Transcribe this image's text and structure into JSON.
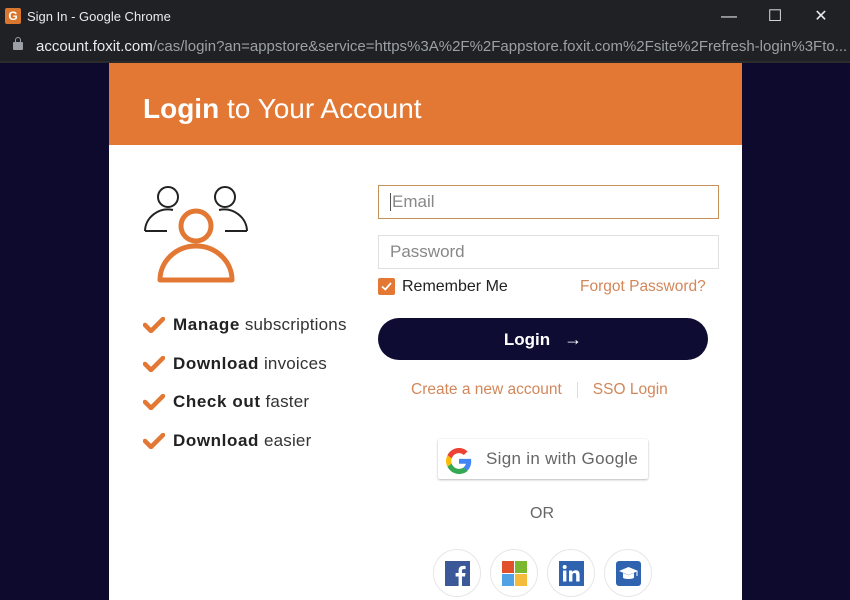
{
  "window": {
    "title": "Sign In - Google Chrome",
    "app_icon_letter": "G",
    "minimize_glyph": "—",
    "maximize_glyph": "☐",
    "close_glyph": "✕"
  },
  "address_bar": {
    "host": "account.foxit.com",
    "path": "/cas/login?an=appstore&service=https%3A%2F%2Fappstore.foxit.com%2Fsite%2Frefresh-login%3Fto..."
  },
  "header": {
    "title_bold": "Login",
    "title_rest": " to Your Account"
  },
  "features": [
    {
      "bold": "Manage",
      "rest": " subscriptions"
    },
    {
      "bold": "Download",
      "rest": " invoices"
    },
    {
      "bold": "Check out",
      "rest": " faster"
    },
    {
      "bold": "Download",
      "rest": " easier"
    }
  ],
  "form": {
    "email_placeholder": "Email",
    "email_value": "",
    "password_placeholder": "Password",
    "password_value": "",
    "remember_label": "Remember Me",
    "remember_checked": true,
    "forgot_label": "Forgot Password?",
    "login_label": "Login",
    "login_arrow": "→",
    "create_account_label": "Create a new account",
    "sso_label": "SSO Login"
  },
  "google": {
    "label": "Sign in with Google"
  },
  "or_label": "OR",
  "social": [
    "facebook",
    "microsoft",
    "linkedin",
    "education"
  ],
  "colors": {
    "brand_orange": "#e27833",
    "navy": "#0e0c33",
    "link": "#d2875a"
  }
}
